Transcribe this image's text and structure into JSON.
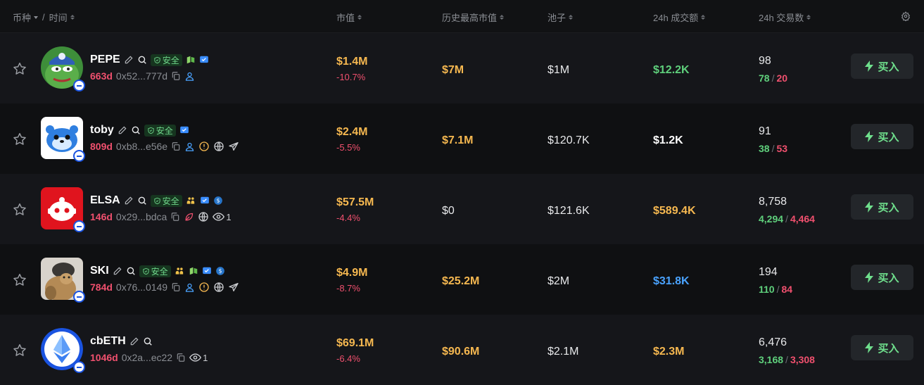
{
  "header": {
    "col_token": "币种",
    "col_sep": "/",
    "col_time": "时间",
    "col_mcap": "市值",
    "col_ath": "历史最高市值",
    "col_pool": "池子",
    "col_vol": "24h 成交额",
    "col_txs": "24h 交易数",
    "settings_icon": "gear-icon"
  },
  "colors": {
    "positive": "#5fd07c",
    "negative": "#f0506e",
    "accent": "#f6b850",
    "blue": "#4aa3ff",
    "safe_bg": "#16351f"
  },
  "rows": [
    {
      "name": "PEPE",
      "safe": "安全",
      "age": "663d",
      "address": "0x52...777d",
      "mcap": "$1.4M",
      "mcap_change": "-10.7%",
      "ath": "$7M",
      "pool": "$1M",
      "volume": "$12.2K",
      "volume_color": "#5fd07c",
      "txs": "98",
      "buys": "78",
      "sells": "20",
      "buy_label": "买入"
    },
    {
      "name": "toby",
      "safe": "安全",
      "age": "809d",
      "address": "0xb8...e56e",
      "mcap": "$2.4M",
      "mcap_change": "-5.5%",
      "ath": "$7.1M",
      "pool": "$120.7K",
      "volume": "$1.2K",
      "volume_color": "#ffffff",
      "txs": "91",
      "buys": "38",
      "sells": "53",
      "buy_label": "买入"
    },
    {
      "name": "ELSA",
      "safe": "安全",
      "age": "146d",
      "address": "0x29...bdca",
      "views": "1",
      "mcap": "$57.5M",
      "mcap_change": "-4.4%",
      "ath": "$0",
      "pool": "$121.6K",
      "volume": "$589.4K",
      "volume_color": "#f6b850",
      "txs": "8,758",
      "buys": "4,294",
      "sells": "4,464",
      "buy_label": "买入"
    },
    {
      "name": "SKI",
      "safe": "安全",
      "age": "784d",
      "address": "0x76...0149",
      "mcap": "$4.9M",
      "mcap_change": "-8.7%",
      "ath": "$25.2M",
      "pool": "$2M",
      "volume": "$31.8K",
      "volume_color": "#4aa3ff",
      "txs": "194",
      "buys": "110",
      "sells": "84",
      "buy_label": "买入"
    },
    {
      "name": "cbETH",
      "age": "1046d",
      "address": "0x2a...ec22",
      "views": "1",
      "mcap": "$69.1M",
      "mcap_change": "-6.4%",
      "ath": "$90.6M",
      "pool": "$2.1M",
      "volume": "$2.3M",
      "volume_color": "#f6b850",
      "txs": "6,476",
      "buys": "3,168",
      "sells": "3,308",
      "buy_label": "买入"
    }
  ]
}
